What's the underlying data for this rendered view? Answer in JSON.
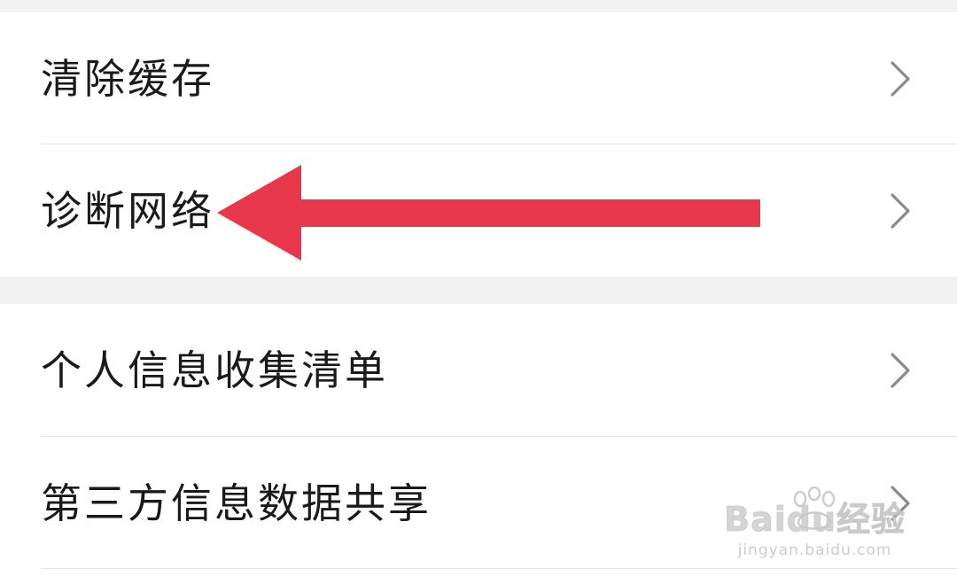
{
  "settings": {
    "group_1": [
      {
        "label": "清除缓存",
        "icon": "chevron-right-icon"
      },
      {
        "label": "诊断网络",
        "icon": "chevron-right-icon"
      }
    ],
    "group_2": [
      {
        "label": "个人信息收集清单",
        "icon": "chevron-right-icon"
      },
      {
        "label": "第三方信息数据共享",
        "icon": "chevron-right-icon"
      }
    ]
  },
  "annotation": {
    "arrow_color": "#e8364a",
    "points_to": "诊断网络"
  },
  "watermark": {
    "brand": "Baidu经验",
    "url": "jingyan.baidu.com"
  },
  "colors": {
    "background": "#f2f2f2",
    "card": "#ffffff",
    "text": "#1a1a1a",
    "chevron": "#8a8a8a",
    "divider": "#e4e4e4"
  }
}
